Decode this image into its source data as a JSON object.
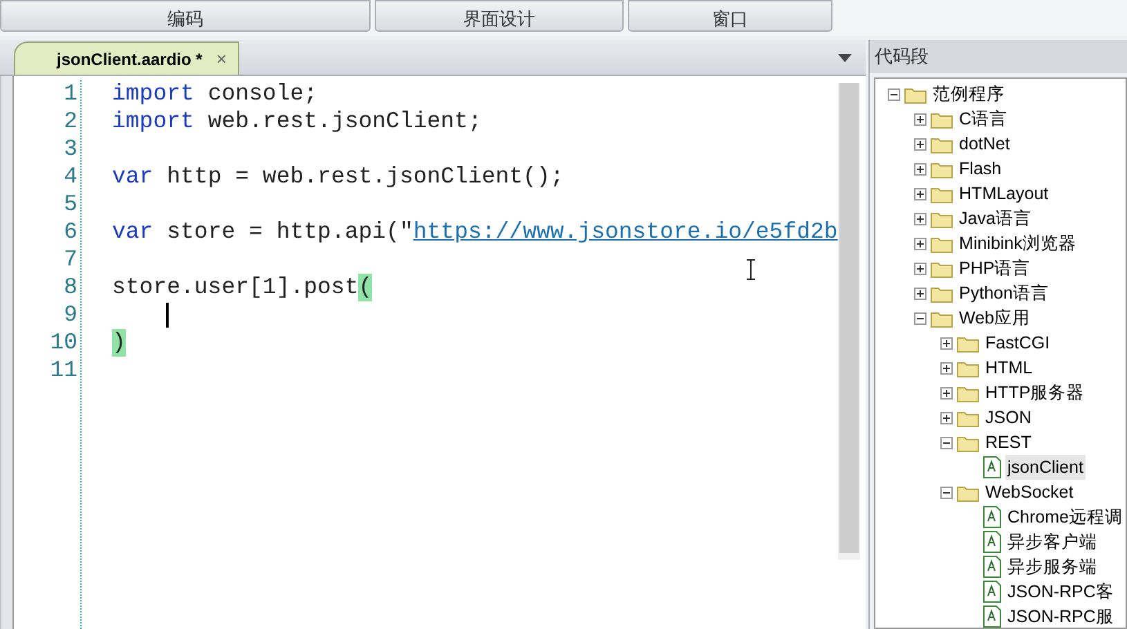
{
  "toolbar": {
    "buttons": [
      {
        "label": "编码"
      },
      {
        "label": "界面设计"
      },
      {
        "label": "窗口"
      }
    ]
  },
  "editor": {
    "tabs": [
      {
        "label": "jsonClient.aardio *",
        "close": "×",
        "selected": true
      }
    ],
    "lines": [
      {
        "number": "1",
        "tokens": [
          {
            "kind": "keyword",
            "text": "import"
          },
          {
            "kind": "plain",
            "text": " console;"
          }
        ]
      },
      {
        "number": "2",
        "tokens": [
          {
            "kind": "keyword",
            "text": "import"
          },
          {
            "kind": "plain",
            "text": " web.rest.jsonClient;"
          }
        ]
      },
      {
        "number": "3"
      },
      {
        "number": "4",
        "tokens": [
          {
            "kind": "keyword",
            "text": "var"
          },
          {
            "kind": "plain",
            "text": " http = web.rest.jsonClient();"
          }
        ]
      },
      {
        "number": "5"
      },
      {
        "number": "6",
        "tokens": [
          {
            "kind": "keyword",
            "text": "var"
          },
          {
            "kind": "plain",
            "text": " store = http.api("
          },
          {
            "kind": "plain",
            "text": "\""
          },
          {
            "kind": "link",
            "text": "https://www.jsonstore.io/e5fd2b"
          }
        ]
      },
      {
        "number": "7"
      },
      {
        "number": "8",
        "tokens": [
          {
            "kind": "plain",
            "text": "store.user[1].post"
          },
          {
            "kind": "match",
            "text": "("
          }
        ]
      },
      {
        "number": "9",
        "caret": true
      },
      {
        "number": "10",
        "tokens": [
          {
            "kind": "match",
            "text": ")"
          }
        ]
      },
      {
        "number": "11"
      }
    ]
  },
  "snippets": {
    "title": "代码段",
    "tree": [
      {
        "label": "范例程序",
        "kind": "folder",
        "expanded": true,
        "selected": false,
        "children": [
          {
            "label": "C语言",
            "kind": "folder",
            "expanded": false,
            "selected": false
          },
          {
            "label": "dotNet",
            "kind": "folder",
            "expanded": false,
            "selected": false
          },
          {
            "label": "Flash",
            "kind": "folder",
            "expanded": false,
            "selected": false
          },
          {
            "label": "HTMLayout",
            "kind": "folder",
            "expanded": false,
            "selected": false
          },
          {
            "label": "Java语言",
            "kind": "folder",
            "expanded": false,
            "selected": false
          },
          {
            "label": "Minibink浏览器",
            "kind": "folder",
            "expanded": false,
            "selected": false
          },
          {
            "label": "PHP语言",
            "kind": "folder",
            "expanded": false,
            "selected": false
          },
          {
            "label": "Python语言",
            "kind": "folder",
            "expanded": false,
            "selected": false
          },
          {
            "label": "Web应用",
            "kind": "folder",
            "expanded": true,
            "selected": false,
            "children": [
              {
                "label": "FastCGI",
                "kind": "folder",
                "expanded": false,
                "selected": false
              },
              {
                "label": "HTML",
                "kind": "folder",
                "expanded": false,
                "selected": false
              },
              {
                "label": "HTTP服务器",
                "kind": "folder",
                "expanded": false,
                "selected": false
              },
              {
                "label": "JSON",
                "kind": "folder",
                "expanded": false,
                "selected": false
              },
              {
                "label": "REST",
                "kind": "folder",
                "expanded": true,
                "selected": false,
                "children": [
                  {
                    "label": "jsonClient",
                    "kind": "file",
                    "selected": true
                  }
                ]
              },
              {
                "label": "WebSocket",
                "kind": "folder",
                "expanded": true,
                "selected": false,
                "children": [
                  {
                    "label": "Chrome远程调",
                    "kind": "file",
                    "selected": false
                  },
                  {
                    "label": "异步客户端",
                    "kind": "file",
                    "selected": false
                  },
                  {
                    "label": "异步服务端",
                    "kind": "file",
                    "selected": false
                  },
                  {
                    "label": "JSON-RPC客",
                    "kind": "file",
                    "selected": false
                  },
                  {
                    "label": "JSON-RPC服",
                    "kind": "file",
                    "selected": false
                  }
                ]
              }
            ]
          }
        ]
      }
    ]
  }
}
